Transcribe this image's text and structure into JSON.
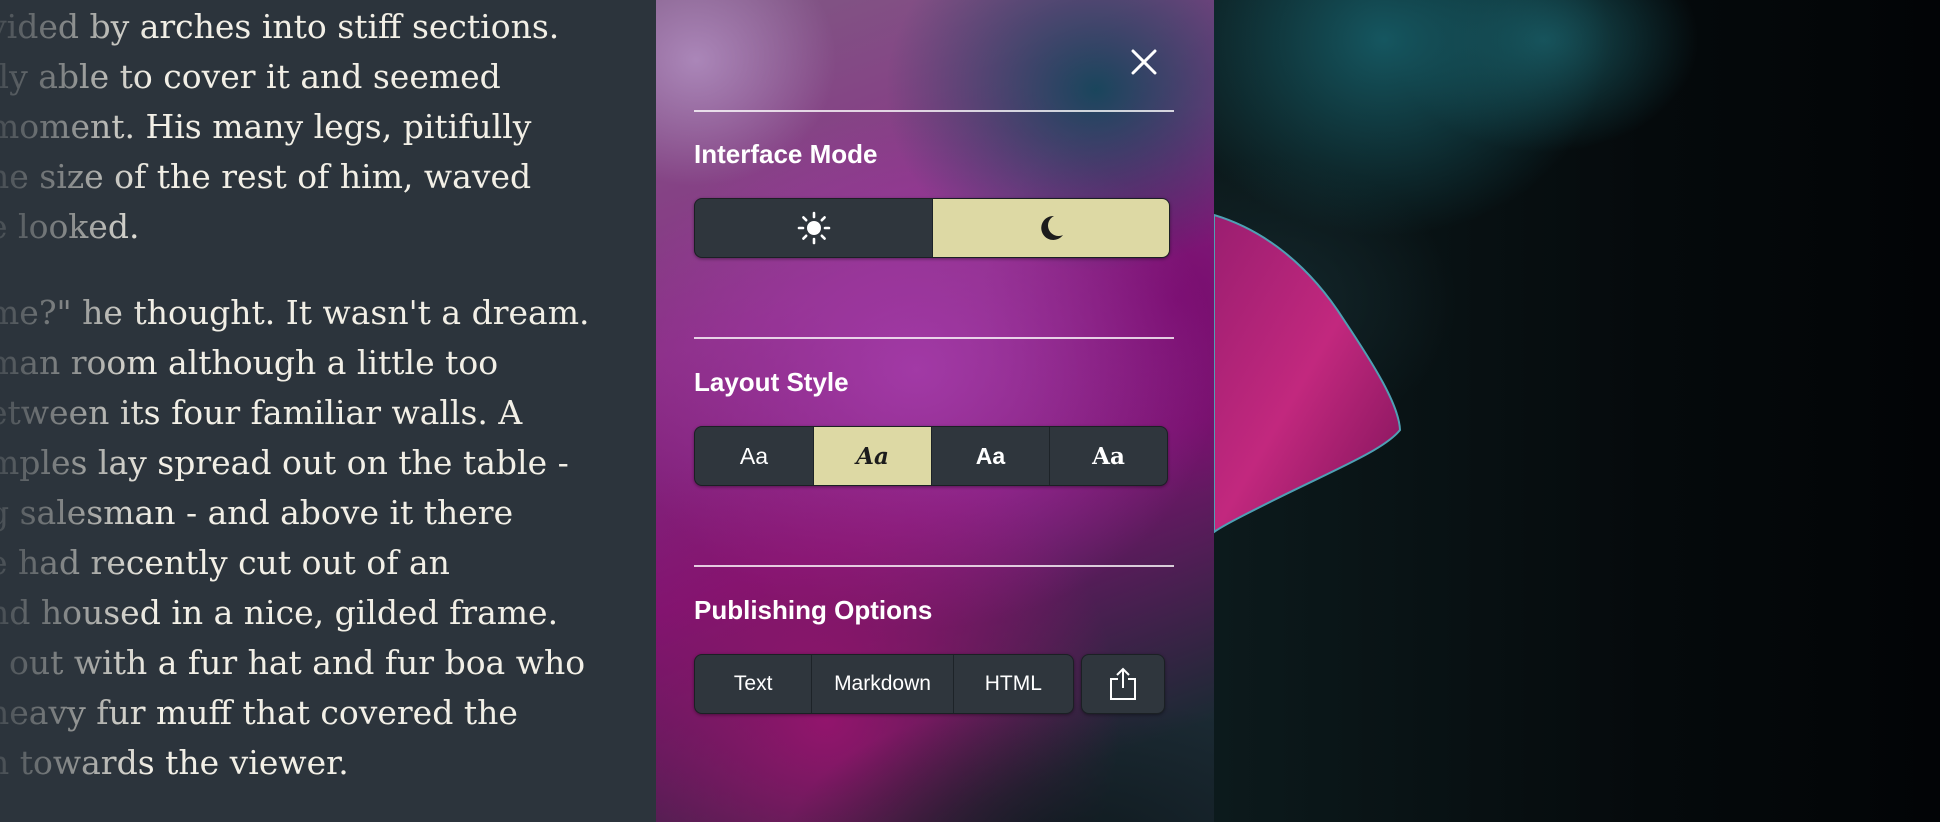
{
  "reader": {
    "paragraphs": [
      {
        "lines": [
          "vided by arches into stiff sections.",
          "lly able to cover it and seemed",
          "moment. His many legs, pitifully",
          "he size of the rest of him, waved",
          "e looked."
        ]
      },
      {
        "lines": [
          "me?\" he thought. It wasn't a dream.",
          "man room although a little too",
          "etween its four familiar walls. A",
          "mples lay spread out on the table -",
          "g salesman - and above it there",
          "e had recently cut out of an",
          "nd housed in a nice, gilded frame.",
          "l out with a fur hat and fur boa who",
          "heavy fur muff that covered the",
          "n towards the viewer."
        ]
      }
    ]
  },
  "settings": {
    "close_icon": "close-icon",
    "interface_mode": {
      "title": "Interface Mode",
      "options": [
        {
          "icon": "sun-icon",
          "selected": false
        },
        {
          "icon": "moon-icon",
          "selected": true
        }
      ]
    },
    "layout_style": {
      "title": "Layout Style",
      "options": [
        {
          "label": "Aa",
          "selected": false
        },
        {
          "label": "Aa",
          "selected": true
        },
        {
          "label": "Aa",
          "selected": false
        },
        {
          "label": "Aa",
          "selected": false
        }
      ]
    },
    "publishing": {
      "title": "Publishing Options",
      "options": [
        "Text",
        "Markdown",
        "HTML"
      ],
      "share_icon": "share-icon"
    }
  },
  "colors": {
    "reader_bg": "#2c343c",
    "reader_text": "#f2efe6",
    "segment_bg": "#2f363d",
    "segment_active": "#ddd9a4"
  }
}
